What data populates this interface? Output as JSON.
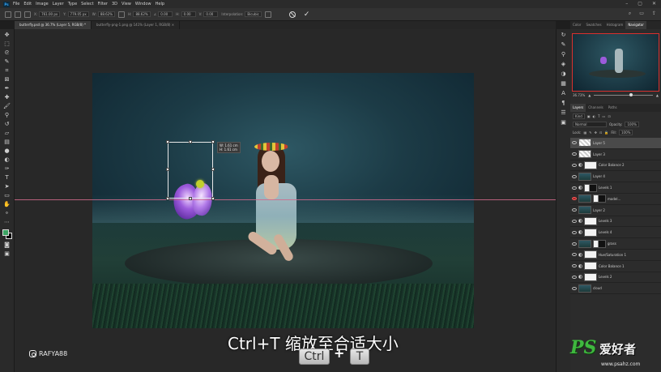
{
  "menubar": {
    "logo": "Ps",
    "items": [
      "File",
      "Edit",
      "Image",
      "Layer",
      "Type",
      "Select",
      "Filter",
      "3D",
      "View",
      "Window",
      "Help"
    ]
  },
  "options": {
    "x_label": "X:",
    "x_value": "761.00 px",
    "y_label": "Y:",
    "y_value": "779.05 px",
    "w_label": "W:",
    "w_value": "88.62%",
    "h_label": "H:",
    "h_value": "88.62%",
    "angle_value": "0.00",
    "hskew_label": "H:",
    "hskew_value": "0.00",
    "vskew_label": "V:",
    "vskew_value": "0.00",
    "interp_label": "Interpolation:",
    "interp_value": "Bicubic"
  },
  "tabs": [
    {
      "label": "butterfly.psd @ 36.7% (Layer 5, RGB/8) *"
    },
    {
      "label": "butterfly-png-1.png @ 141% (Layer 1, RGB/8) ×"
    }
  ],
  "canvas": {
    "tooltip_w": "W: 1.61 cm",
    "tooltip_h": "H: 1.61 cm"
  },
  "overlay": {
    "subtitle": "Ctrl+T 缩放至合适大小",
    "key1": "Ctrl",
    "key_plus": "+",
    "key2": "T",
    "watermark": "RAFYA88"
  },
  "right_panel": {
    "tabs": [
      "Color",
      "Swatches",
      "Histogram",
      "Navigator"
    ],
    "zoom": "36.73%",
    "layer_tabs": [
      "Layers",
      "Channels",
      "Paths"
    ],
    "kind_label": "Kind",
    "blend_mode": "Normal",
    "opacity_label": "Opacity:",
    "opacity_value": "100%",
    "lock_label": "Lock:",
    "fill_label": "Fill:",
    "fill_value": "100%",
    "layers": [
      {
        "name": "Layer 5",
        "thumb": "check",
        "selected": true
      },
      {
        "name": "Layer 3",
        "thumb": "check"
      },
      {
        "name": "Color Balance 2",
        "thumb": "adj"
      },
      {
        "name": "Layer 4",
        "thumb": "scene"
      },
      {
        "name": "Levels 1",
        "thumb": "adj-dark"
      },
      {
        "name": "model...",
        "thumb": "scene",
        "eye_red": true
      },
      {
        "name": "Layer 2",
        "thumb": "scene"
      },
      {
        "name": "Levels 3",
        "thumb": "adj"
      },
      {
        "name": "Levels 4",
        "thumb": "adj"
      },
      {
        "name": "grass",
        "thumb": "scene"
      },
      {
        "name": "Hue/Saturation 1",
        "thumb": "adj"
      },
      {
        "name": "Color Balance 1",
        "thumb": "adj"
      },
      {
        "name": "Levels 2",
        "thumb": "adj"
      },
      {
        "name": "cloud",
        "thumb": "scene"
      }
    ]
  },
  "watermark_site": {
    "logo": "PS",
    "cn": "爱好者",
    "url": "www.psahz.com"
  },
  "colors": {
    "foreground": "#3ba463",
    "background": "#000000",
    "guide": "#d06a8c",
    "navigator_frame": "#d9302e"
  }
}
